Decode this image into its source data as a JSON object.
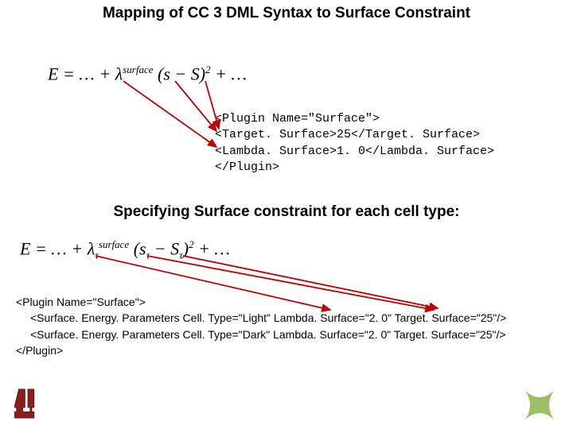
{
  "title": "Mapping of CC 3 DML Syntax to Surface Constraint",
  "equation1": "E = … + λsurface (s − S)2 + …",
  "code1": {
    "l1": "<Plugin Name=\"Surface\">",
    "l2": "<Target. Surface>25</Target. Surface>",
    "l3": "<Lambda. Surface>1. 0</Lambda. Surface>",
    "l4": "</Plugin>"
  },
  "subtitle": "Specifying Surface constraint for each cell type:",
  "equation2": "E = … + λτsurface (sτ − Sτ)2 + …",
  "code2": {
    "l1": "<Plugin Name=\"Surface\">",
    "l2": "<Surface. Energy. Parameters Cell. Type=\"Light\" Lambda. Surface=\"2. 0\" Target. Surface=\"25\"/>",
    "l3": "<Surface. Energy. Parameters Cell. Type=\"Dark\" Lambda. Surface=\"2. 0\" Target. Surface=\"25\"/>",
    "l4": "</Plugin>"
  },
  "chart_data": {
    "type": "table",
    "title": "CC3DML Surface Constraint Plugin parameters",
    "global": {
      "Plugin": "Surface",
      "TargetSurface": 25,
      "LambdaSurface": 1.0
    },
    "per_cell_type": [
      {
        "CellType": "Light",
        "LambdaSurface": 2.0,
        "TargetSurface": 25
      },
      {
        "CellType": "Dark",
        "LambdaSurface": 2.0,
        "TargetSurface": 25
      }
    ],
    "equations": [
      "E = ... + λ^surface (s − S)^2 + ...",
      "E = ... + λ_τ^surface (s_τ − S_τ)^2 + ..."
    ]
  }
}
